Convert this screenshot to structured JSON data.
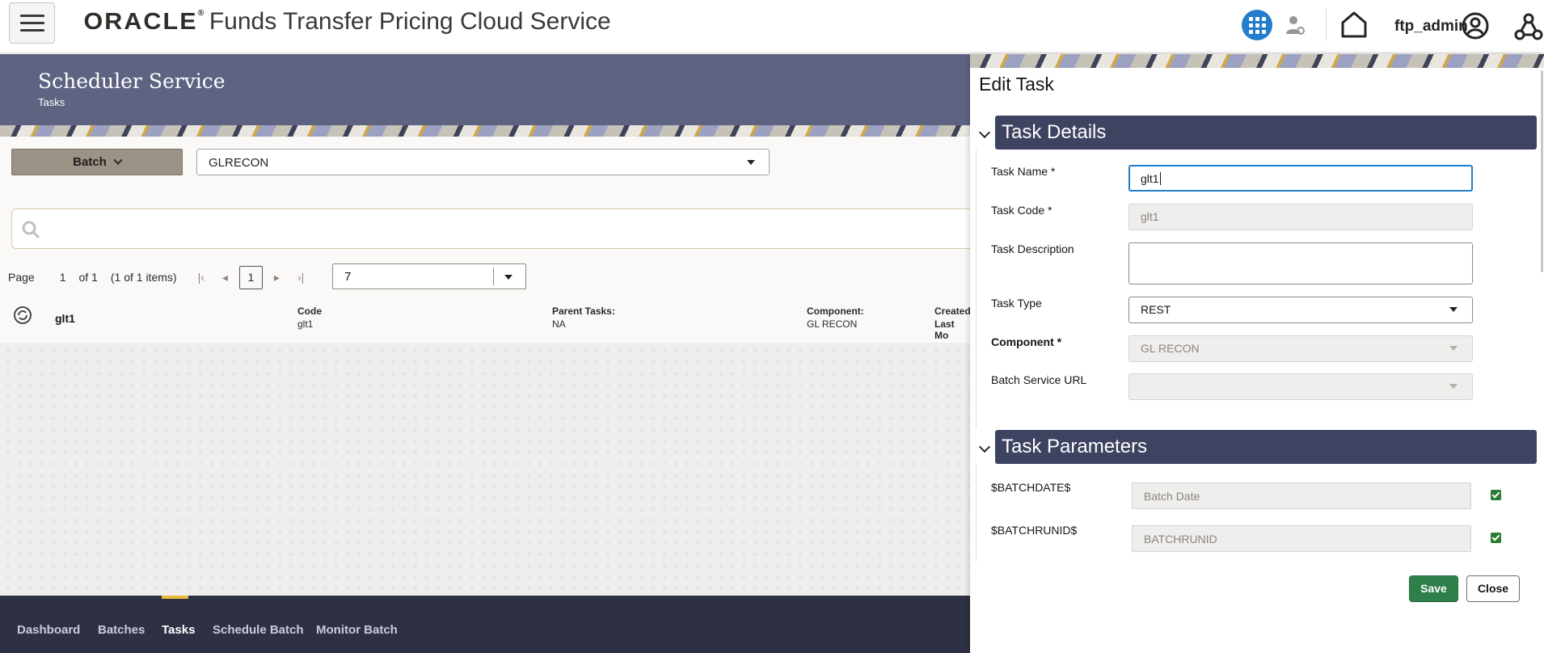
{
  "header": {
    "logo": "ORACLE",
    "app_title": "Funds Transfer Pricing Cloud Service",
    "username": "ftp_admin",
    "icons": [
      "hamburger-menu-icon",
      "apps-grid-icon",
      "user-settings-icon",
      "home-icon",
      "account-icon",
      "network-icon"
    ],
    "accent_color": "#227ecb"
  },
  "banner": {
    "title": "Scheduler Service",
    "subtitle": "Tasks"
  },
  "toolbar": {
    "batch_label": "Batch",
    "batch_select_value": "GLRECON"
  },
  "search": {
    "placeholder": ""
  },
  "pagination": {
    "page_label": "Page",
    "current_page": "1",
    "of_label": "of 1",
    "items_label": "(1 of 1 items)",
    "page_button": "1",
    "page_size": "7"
  },
  "task_list": {
    "rows": [
      {
        "name": "glt1",
        "code_label": "Code",
        "code_value": "glt1",
        "parent_label": "Parent Tasks:",
        "parent_value": "NA",
        "component_label": "Component:",
        "component_value": "GL RECON",
        "created_label": "Created",
        "modified_label": "Last Mo"
      }
    ]
  },
  "footer_nav": {
    "tabs": [
      "Dashboard",
      "Batches",
      "Tasks",
      "Schedule Batch",
      "Monitor Batch"
    ],
    "active": "Tasks"
  },
  "drawer": {
    "title": "Edit Task",
    "task_details": {
      "heading": "Task Details",
      "task_name_label": "Task Name *",
      "task_name_value": "glt1",
      "task_code_label": "Task Code *",
      "task_code_value": "glt1",
      "task_description_label": "Task Description",
      "task_description_value": "",
      "task_type_label": "Task Type",
      "task_type_value": "REST",
      "component_label": "Component *",
      "component_value": "GL RECON",
      "batch_url_label": "Batch Service URL",
      "batch_url_value": ""
    },
    "task_parameters": {
      "heading": "Task Parameters",
      "params": [
        {
          "label": "$BATCHDATE$",
          "placeholder": "Batch Date",
          "checked": true
        },
        {
          "label": "$BATCHRUNID$",
          "placeholder": "BATCHRUNID",
          "checked": true
        }
      ]
    },
    "save_label": "Save",
    "close_label": "Close",
    "save_color": "#2f7f4b",
    "section_color": "#3d4360"
  }
}
